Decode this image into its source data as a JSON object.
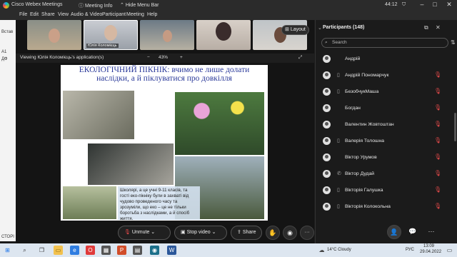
{
  "titlebar": {
    "app_title": "Cisco Webex Meetings",
    "meeting_info": "Meeting Info",
    "hide_menu": "Hide Menu Bar",
    "time": "44:12"
  },
  "menu": [
    "File",
    "Edit",
    "Share",
    "View",
    "Audio & Video",
    "Participant",
    "Meeting",
    "Help"
  ],
  "left_strip": {
    "paste": "Встав",
    "row1": "A1",
    "row2": "ДФ",
    "status": "СТОРІ"
  },
  "videos": {
    "featured_name": "Юлія Коломієць",
    "layout_label": "Layout"
  },
  "view_bar": {
    "viewing": "Viewing Юлія Коломієць's application(s)",
    "zoom_out": "−",
    "zoom": "43%",
    "zoom_in": "+"
  },
  "slide": {
    "title_line1": "ЕКОЛОГІЧНИЙ ПІКНІК: вчимо не лише долати",
    "title_line2": "наслідки, а й піклуватися про довкілля",
    "caption": "Школярі, а це учні 9-11 класів, та гості еко-пікніку були в захваті від чудово проведеного часу та зрозуміли, що еко – це не тільки боротьба з наслідками, а й спосіб життя."
  },
  "controls": {
    "mute": "Unmute",
    "video": "Stop video",
    "share": "Share",
    "more": "···"
  },
  "participants": {
    "title": "Participants (148)",
    "search_placeholder": "Search",
    "list": [
      {
        "name": "Андрій"
      },
      {
        "name": "Андрій Пономарчук"
      },
      {
        "name": "БезобчукМаша"
      },
      {
        "name": "Богдан"
      },
      {
        "name": "Валентин Жовтоштан"
      },
      {
        "name": "Валерія Толошна"
      },
      {
        "name": "Віктор Урумов"
      },
      {
        "name": "Віктор Дудай"
      },
      {
        "name": "Вікторія Галушка"
      },
      {
        "name": "Вікторія Колокольна"
      }
    ]
  },
  "taskbar": {
    "weather": "14°C Cloudy",
    "lang": "РУС",
    "time": "13:09",
    "date": "29.04.2022"
  },
  "colors": {
    "mute_red": "#e74b4b",
    "end_red": "#e5313b",
    "slide_title": "#2b3a9a"
  }
}
